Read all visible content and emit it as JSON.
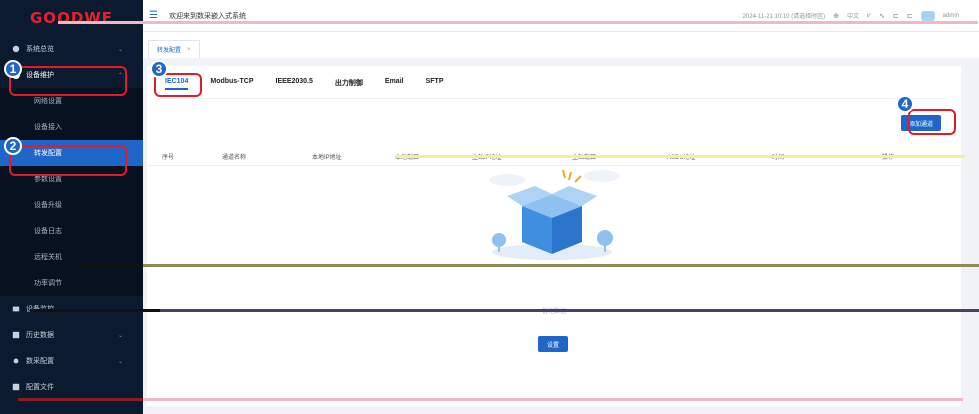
{
  "brand": {
    "logo_text": "GOODWE",
    "logo_color": "#e8202e"
  },
  "header": {
    "welcome": "欢迎来到数采嵌入式系统",
    "datetime": "2024-11-21 10:10 (请选择时区)",
    "language": "中文",
    "user": "admin"
  },
  "sidebar": {
    "items": [
      {
        "label": "系统总览",
        "icon": "dashboard-icon",
        "arrow": "⌄"
      },
      {
        "label": "设备维护",
        "icon": "maintenance-icon",
        "arrow": "⌃"
      }
    ],
    "subitems": [
      "网络设置",
      "设备接入",
      "转发配置",
      "参数设置",
      "设备升级",
      "设备日志",
      "远程关机",
      "功率调节"
    ],
    "bottom_items": [
      {
        "label": "设备监控",
        "icon": "monitor-icon"
      },
      {
        "label": "历史数据",
        "icon": "history-icon",
        "arrow": "⌄"
      },
      {
        "label": "数采配置",
        "icon": "config-icon",
        "arrow": "⌄"
      },
      {
        "label": "配置文件",
        "icon": "file-icon"
      }
    ]
  },
  "page_tab": {
    "label": "转发配置",
    "close": "×"
  },
  "protocol_tabs": [
    "IEC104",
    "Modbus-TCP",
    "IEEE2030.5",
    "出力制御",
    "Email",
    "SFTP"
  ],
  "add_button": "添加通道",
  "table": {
    "columns": [
      "序号",
      "通道名称",
      "本地IP地址",
      "本地端口",
      "主站IP地址",
      "主站端口",
      "ASDU地址",
      "时间",
      "操作"
    ]
  },
  "empty_text": "暂无数据",
  "set_button": "设置",
  "callouts": [
    "1",
    "2",
    "3",
    "4"
  ],
  "colors": {
    "accent": "#1e67c9",
    "highlight": "#e11b2a",
    "sidebar_bg": "#0b1a2e"
  }
}
